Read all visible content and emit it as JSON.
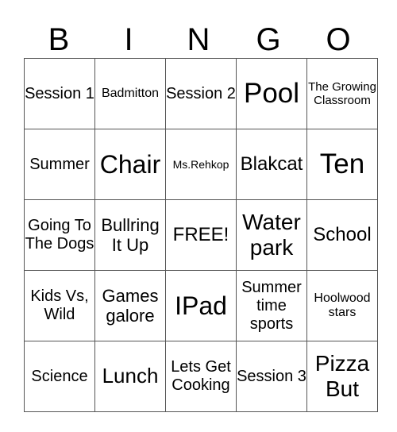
{
  "header": [
    "B",
    "I",
    "N",
    "G",
    "O"
  ],
  "rows": [
    [
      "Session 1",
      "Badmitton",
      "Session 2",
      "Pool",
      "The Growing Classroom"
    ],
    [
      "Summer",
      "Chair",
      "Ms.Rehkop",
      "Blakcat",
      "Ten"
    ],
    [
      "Going To The Dogs",
      "Bullring It Up",
      "FREE!",
      "Water park",
      "School"
    ],
    [
      "Kids Vs, Wild",
      "Games galore",
      "IPad",
      "Summer time sports",
      "Hoolwood stars"
    ],
    [
      "Science",
      "Lunch",
      "Lets Get Cooking",
      "Session 3",
      "Pizza But"
    ]
  ]
}
